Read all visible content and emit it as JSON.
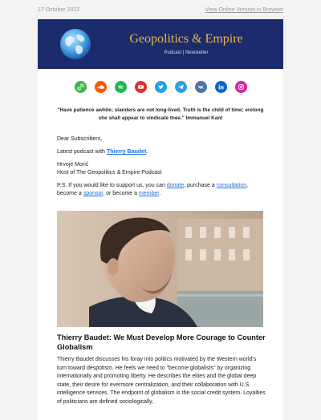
{
  "top": {
    "date": "17 October 2022",
    "view_online": "View Online Version in Browser"
  },
  "header": {
    "title": "Geopolitics & Empire",
    "subtitle": "Podcast | Newsletter"
  },
  "socials": [
    {
      "name": "link",
      "color": "#3bb54a"
    },
    {
      "name": "soundcloud",
      "color": "#ff5500"
    },
    {
      "name": "spotify",
      "color": "#1db954"
    },
    {
      "name": "youtube",
      "color": "#e52d27"
    },
    {
      "name": "twitter",
      "color": "#1da1f2"
    },
    {
      "name": "telegram",
      "color": "#2aa3df"
    },
    {
      "name": "vk",
      "color": "#4c75a3"
    },
    {
      "name": "linkedin",
      "color": "#0a66c2"
    },
    {
      "name": "instagram",
      "color": "#d6249f"
    }
  ],
  "quote": "\"Have patience awhile; slanders are not long-lived. Truth is the child of time; erelong she shall appear to vindicate thee.\" Immanuel Kant",
  "greeting": "Dear Subscribers,",
  "latest": {
    "prefix": "Latest podcast with ",
    "link": "Thierry Baudet",
    "suffix": "."
  },
  "signature": {
    "name": "Hrvoje Morić",
    "role": "Host of The Geopolitics & Empire Podcast"
  },
  "ps": {
    "t1": "P.S. If you would like to support us, you can ",
    "donate": "donate",
    "t2": ", purchase a ",
    "consultation": "consultation",
    "t3": ", become a ",
    "sponsor": "sponsor",
    "t4": ", or become a ",
    "member": "member",
    "t5": "."
  },
  "article": {
    "title": "Thierry Baudet: We Must Develop More Courage to Counter Globalism",
    "body": "Thierry Baudet discusses his foray into politics motivated by the Western world's turn toward despotism. He feels we need to \"become globalists\" by organizing internationally and promoting liberty. He describes the elites and the global deep state, their desire for evermore centralization, and their collaboration with U.S. intelligence services. The endpoint of globalism is the social credit system. Loyalties of politicians are defined sociologically,"
  }
}
